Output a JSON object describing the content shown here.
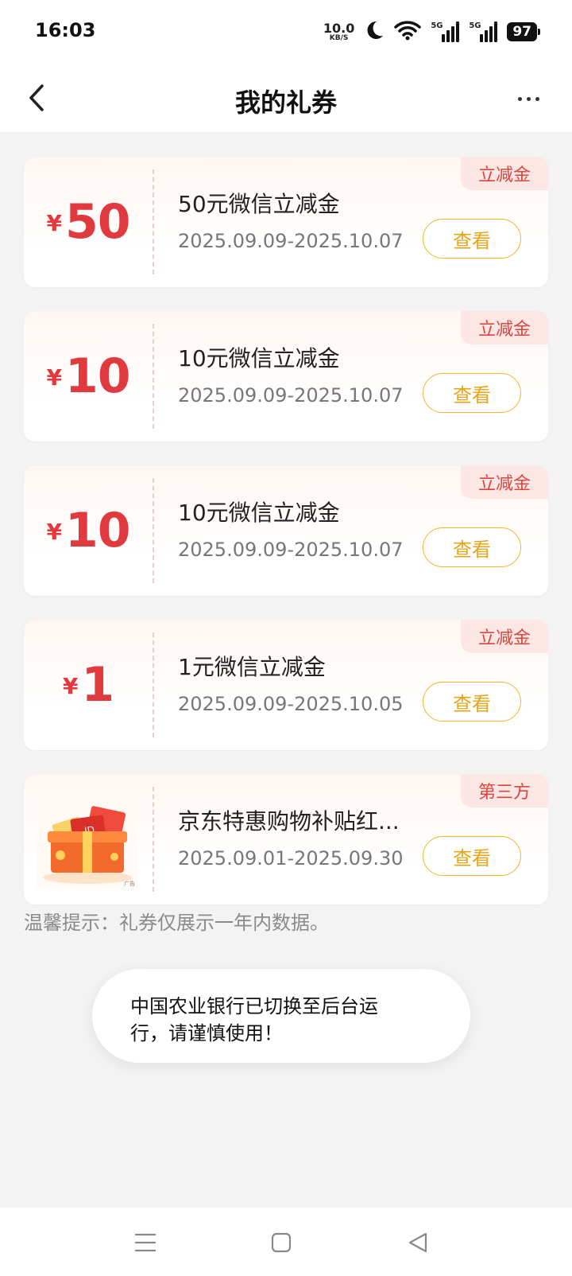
{
  "status": {
    "time": "16:03",
    "net_speed_value": "10.0",
    "net_speed_unit": "KB/S",
    "signal1_label": "5G",
    "signal2_label": "5G",
    "battery": "97"
  },
  "header": {
    "title": "我的礼券"
  },
  "coupons": [
    {
      "yen": "¥",
      "amount": "50",
      "name": "50元微信立减金",
      "date": "2025.09.09-2025.10.07",
      "tag": "立减金",
      "button": "查看"
    },
    {
      "yen": "¥",
      "amount": "10",
      "name": "10元微信立减金",
      "date": "2025.09.09-2025.10.07",
      "tag": "立减金",
      "button": "查看"
    },
    {
      "yen": "¥",
      "amount": "10",
      "name": "10元微信立减金",
      "date": "2025.09.09-2025.10.07",
      "tag": "立减金",
      "button": "查看"
    },
    {
      "yen": "¥",
      "amount": "1",
      "name": "1元微信立减金",
      "date": "2025.09.09-2025.10.05",
      "tag": "立减金",
      "button": "查看"
    },
    {
      "image": "gift-box",
      "image_label": "广告",
      "name": "京东特惠购物补贴红...",
      "date": "2025.09.01-2025.09.30",
      "tag": "第三方",
      "button": "查看"
    }
  ],
  "tip": "温馨提示：礼券仅展示一年内数据。",
  "toast": {
    "line1": "中国农业银行已切换至后台运",
    "line2": "行，请谨慎使用！"
  },
  "colors": {
    "accent_red": "#e03a3e",
    "tag_bg": "#fde7e5",
    "button_gold": "#f2b62e"
  }
}
